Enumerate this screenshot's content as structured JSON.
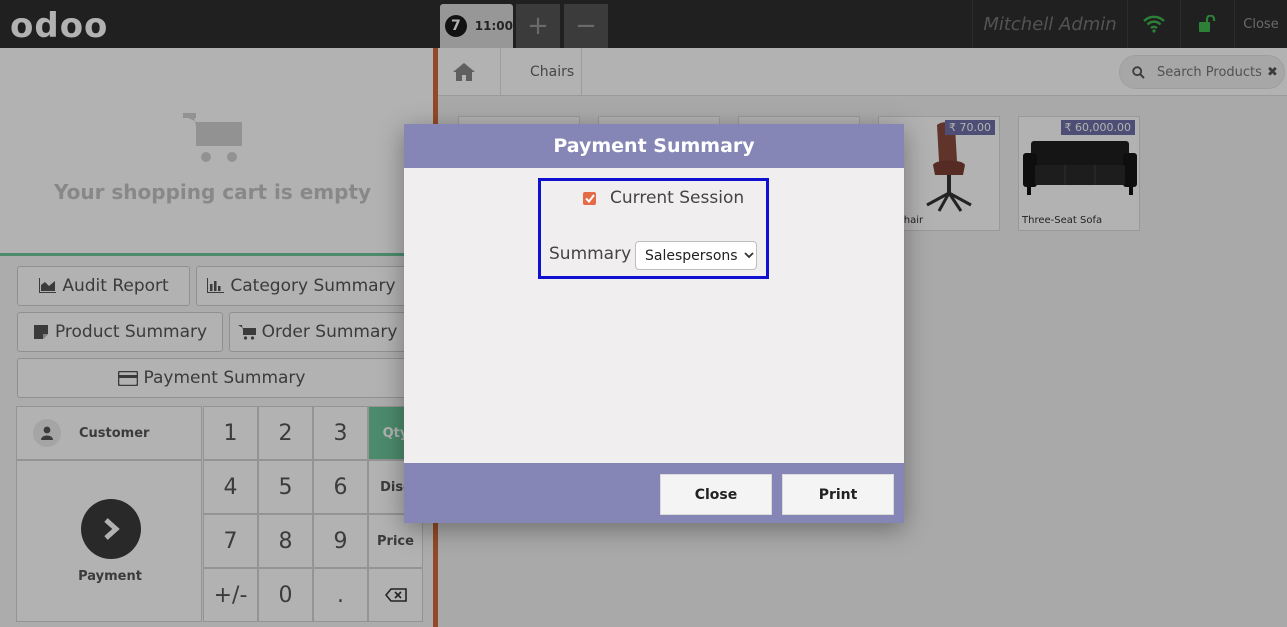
{
  "app": {
    "logo": "odoo"
  },
  "topbar": {
    "order_number": "7",
    "order_time": "11:00",
    "add_label": "+",
    "remove_label": "−",
    "user_name": "Mitchell Admin",
    "close_label": "Close",
    "wifi_color": "#3fb950",
    "lock_color": "#3fb950"
  },
  "cart": {
    "empty_text": "Your shopping cart is empty"
  },
  "controls": {
    "audit_report": "Audit Report",
    "category_summary": "Category Summary",
    "product_summary": "Product Summary",
    "order_summary": "Order Summary",
    "payment_summary": "Payment Summary"
  },
  "numpad": {
    "customer_label": "Customer",
    "payment_label": "Payment",
    "keys": [
      "1",
      "2",
      "3",
      "4",
      "5",
      "6",
      "7",
      "8",
      "9",
      "+/-",
      "0",
      "."
    ],
    "mode_qty": "Qty",
    "mode_disc": "Disc",
    "mode_price": "Price",
    "accent": "#6ec89b"
  },
  "products": {
    "breadcrumb": "Chairs",
    "search_placeholder": "Search Products",
    "items": [
      {
        "name": "ce Chair",
        "price": "₹ 70.00"
      },
      {
        "name": "Three-Seat Sofa",
        "price": "₹ 60,000.00"
      }
    ]
  },
  "modal": {
    "title": "Payment Summary",
    "current_session_label": "Current Session",
    "current_session_checked": true,
    "summary_label": "Summary",
    "summary_selected": "Salespersons",
    "close_label": "Close",
    "print_label": "Print",
    "header_color": "#8586b5",
    "highlight_color": "#1010d0"
  }
}
